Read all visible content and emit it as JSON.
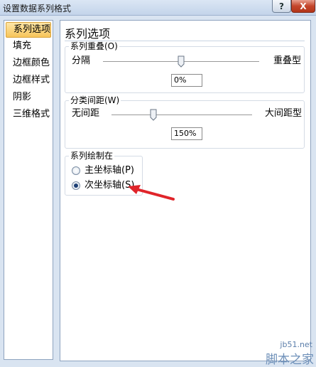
{
  "window": {
    "title": "设置数据系列格式",
    "help_label": "?",
    "close_label": "X"
  },
  "sidebar": {
    "items": [
      {
        "label": "系列选项",
        "selected": true
      },
      {
        "label": "填充",
        "selected": false
      },
      {
        "label": "边框颜色",
        "selected": false
      },
      {
        "label": "边框样式",
        "selected": false
      },
      {
        "label": "阴影",
        "selected": false
      },
      {
        "label": "三维格式",
        "selected": false
      }
    ]
  },
  "panel": {
    "heading": "系列选项",
    "overlap": {
      "group_label": "系列重叠(O)",
      "left_label": "分隔",
      "right_label": "重叠型",
      "value": "0%",
      "level_fraction": 0.5
    },
    "gap": {
      "group_label": "分类间距(W)",
      "left_label": "无间距",
      "right_label": "大间距型",
      "value": "150%",
      "level_fraction": 0.3
    },
    "plot_on": {
      "group_label": "系列绘制在",
      "options": [
        {
          "label": "主坐标轴(P)",
          "checked": false
        },
        {
          "label": "次坐标轴(S)",
          "checked": true
        }
      ]
    }
  },
  "watermark": {
    "url": "jb51.net",
    "text": "脚本之家"
  },
  "colors": {
    "arrow": "#e0242a",
    "selected_item": "#f7c55b",
    "window_bg": "#d9e4f1"
  }
}
